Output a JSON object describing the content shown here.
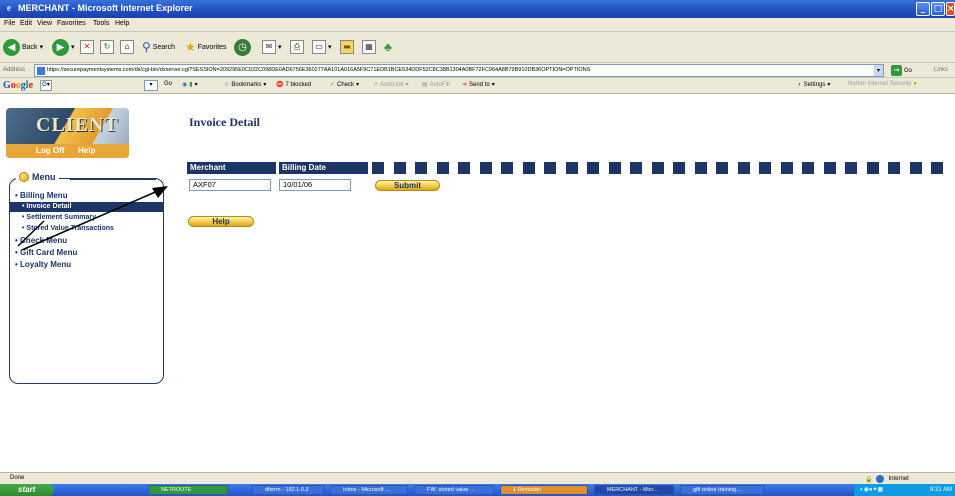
{
  "window": {
    "title": "MERCHANT - Microsoft Internet Explorer",
    "min_glyph": "_",
    "max_glyph": "□",
    "close_glyph": "×"
  },
  "menubar": [
    "File",
    "Edit",
    "View",
    "Favorites",
    "Tools",
    "Help"
  ],
  "toolbar": {
    "back": "Back",
    "search": "Search",
    "favorites": "Favorites"
  },
  "address": {
    "label": "Address",
    "url": "https://securepaymentsystems.com/dx/cgi-bin/dxserver.cgi?SESSION=209295E0C022C098DE0AD6756E360277AA101A016A5F9C71EDB1BCE534DDF52C8C38B1304A0BF72FC964A8B79B910DB36OPTION=OPTIONS",
    "go": "Go",
    "links": "Links"
  },
  "googlebar": {
    "go": "Go",
    "bookmarks": "Bookmarks",
    "blocked": "7 blocked",
    "check": "Check",
    "autolink": "AutoLink",
    "autofill": "AutoFill",
    "send": "Send to",
    "settings": "Settings",
    "norton": "Norton Internet Security"
  },
  "logo": {
    "word": "CLIENT",
    "logoff": "Log Off",
    "help": "Help"
  },
  "menu": {
    "title": "Menu",
    "items": [
      {
        "label": "• Billing Menu",
        "type": "main"
      },
      {
        "label": "• Invoice Detail",
        "type": "sub-selected"
      },
      {
        "label": "• Settlement Summary",
        "type": "sub"
      },
      {
        "label": "• Stored Value Transactions",
        "type": "sub"
      },
      {
        "label": "• Check Menu",
        "type": "main"
      },
      {
        "label": "• Gift Card Menu",
        "type": "main"
      },
      {
        "label": "• Loyalty Menu",
        "type": "main"
      }
    ]
  },
  "page": {
    "heading": "Invoice Detail",
    "merchant_label": "Merchant",
    "billing_date_label": "Billing Date",
    "merchant_value": "AXF07",
    "billing_date_value": "10/01/06",
    "submit": "Submit",
    "help": "Help"
  },
  "status": {
    "text": "Done",
    "zone": "Internet"
  },
  "taskbar": {
    "start": "start",
    "tasks": [
      "NETROUTE",
      "dtterm - 192.1.0.3",
      "Inbox - Microsoft ...",
      "FW: stored value ...",
      "1 Reminder",
      "MERCHANT - Micr...",
      "gift online training..."
    ],
    "clock": "9:31 AM"
  }
}
